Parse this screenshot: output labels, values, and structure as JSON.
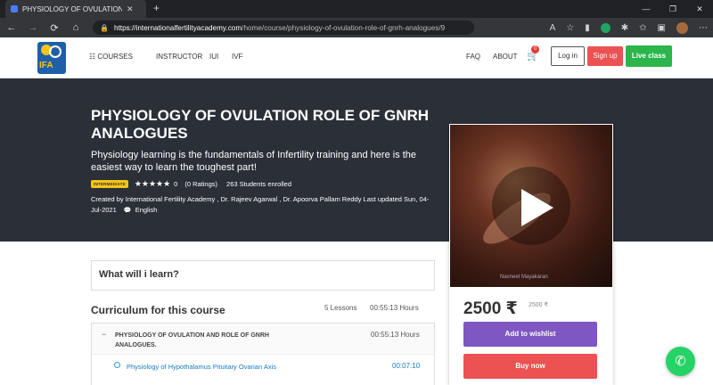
{
  "browser": {
    "tab_title": "PHYSIOLOGY OF OVULATION RC",
    "tab_close": "✕",
    "new_tab": "+",
    "url_host": "https://internationalfertilityacademy.com",
    "url_path": "/home/course/physiology-of-ovulation-role-of-gnrh-analogues/9",
    "back_icon": "←",
    "forward_icon": "→",
    "reload_icon": "⟳",
    "home_icon": "⌂",
    "lock_icon": "🔒",
    "win_min": "—",
    "win_max": "❐",
    "win_close": "✕"
  },
  "header": {
    "logo_text": "IFA",
    "nav": {
      "courses": "☷ COURSES",
      "instructor": "INSTRUCTOR",
      "iui": "IUI",
      "ivf": "IVF"
    },
    "faq": "FAQ",
    "about": "ABOUT",
    "cart_count": "0",
    "cart_icon": "🛒",
    "login": "Log in",
    "signup": "Sign up",
    "live_class": "Live class"
  },
  "course": {
    "title": "PHYSIOLOGY OF OVULATION ROLE OF GNRH ANALOGUES",
    "subtitle": "Physiology learning is the fundamentals of Infertility training and here is the easiest way to learn the toughest part!",
    "level_badge": "INTERMEDIATE",
    "stars": "★★★★★",
    "rating_value": "0",
    "ratings_text": "(0 Ratings)",
    "enrolled": "263 Students enrolled",
    "created_by": "Created by International Fertility Academy , Dr. Rajeev Agarwal , Dr. Apoorva Pallam Reddy    Last updated Sun, 04-Jul-2021",
    "language_icon": "💬",
    "language": "English"
  },
  "sidebar_card": {
    "price": "2500 ₹",
    "original_price": "2500 ₹",
    "wishlist": "Add to wishlist",
    "buy": "Buy now",
    "video_watermark": "Navneet Mayakaran"
  },
  "content": {
    "learn_heading": "What will i learn?",
    "curriculum_heading": "Curriculum for this course",
    "lessons_count": "5 Lessons",
    "total_duration": "00:55:13 Hours",
    "section": {
      "toggle": "−",
      "name": "PHYSIOLOGY OF OVULATION AND ROLE OF GNRH ANALOGUES.",
      "duration": "00:55:13 Hours",
      "lessons": [
        {
          "name": "Physiology of Hypothalamus Pituitary Ovarian Axis",
          "duration": "00:07:10"
        }
      ]
    }
  },
  "whatsapp_icon": "✆",
  "colors": {
    "hero_bg": "#2a2f38",
    "signup": "#ec5252",
    "live": "#2bb54a",
    "wishlist": "#7e57c2",
    "buy": "#ec5252",
    "whatsapp": "#25d366"
  }
}
